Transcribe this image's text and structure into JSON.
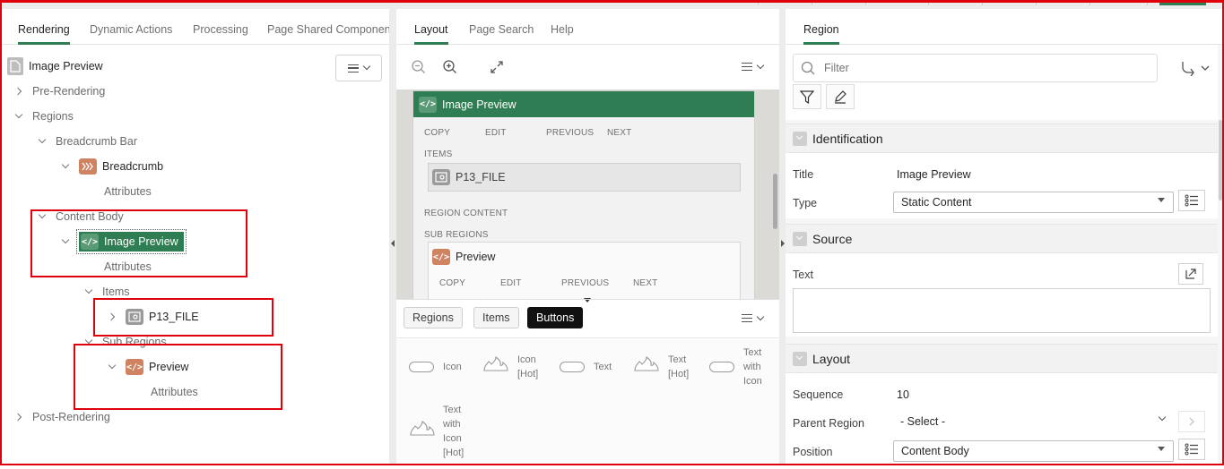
{
  "left": {
    "tabs": [
      "Rendering",
      "Dynamic Actions",
      "Processing",
      "Page Shared Component"
    ],
    "page_title": "Image Preview",
    "tree": {
      "pre_rendering": "Pre-Rendering",
      "regions": "Regions",
      "breadcrumb_bar": "Breadcrumb Bar",
      "breadcrumb": "Breadcrumb",
      "breadcrumb_attributes": "Attributes",
      "content_body": "Content Body",
      "image_preview": "Image Preview",
      "image_preview_attributes": "Attributes",
      "items": "Items",
      "p13_file": "P13_FILE",
      "sub_regions": "Sub Regions",
      "preview": "Preview",
      "preview_attributes": "Attributes",
      "post_rendering": "Post-Rendering"
    }
  },
  "middle": {
    "tabs": [
      "Layout",
      "Page Search",
      "Help"
    ],
    "region": {
      "title": "Image Preview",
      "slots": [
        "COPY",
        "EDIT",
        "PREVIOUS",
        "NEXT"
      ],
      "items_label": "ITEMS",
      "item_name": "P13_FILE",
      "region_content_label": "REGION CONTENT",
      "sub_regions_label": "SUB REGIONS",
      "sub_region": {
        "title": "Preview",
        "slots": [
          "COPY",
          "EDIT",
          "PREVIOUS",
          "NEXT"
        ]
      }
    },
    "gallery_tabs": [
      "Regions",
      "Items",
      "Buttons"
    ],
    "gallery_items": {
      "icon": "Icon",
      "icon_hot_1": "Icon",
      "icon_hot_2": "[Hot]",
      "text": "Text",
      "text_hot_1": "Text",
      "text_hot_2": "[Hot]",
      "text_with_icon_1": "Text",
      "text_with_icon_2": "with",
      "text_with_icon_3": "Icon",
      "twih_1": "Text",
      "twih_2": "with",
      "twih_3": "Icon",
      "twih_4": "[Hot]"
    }
  },
  "right": {
    "tab": "Region",
    "filter_placeholder": "Filter",
    "sections": {
      "identification": {
        "heading": "Identification",
        "title_label": "Title",
        "title_value": "Image Preview",
        "type_label": "Type",
        "type_value": "Static Content"
      },
      "source": {
        "heading": "Source",
        "text_label": "Text"
      },
      "layout": {
        "heading": "Layout",
        "sequence_label": "Sequence",
        "sequence_value": "10",
        "parent_label": "Parent Region",
        "parent_value": "- Select -",
        "position_label": "Position",
        "position_value": "Content Body"
      }
    }
  },
  "colors": {
    "accent_green": "#2f7d52",
    "annotation_red": "#e0000b",
    "region_icon": "#cf8360"
  }
}
